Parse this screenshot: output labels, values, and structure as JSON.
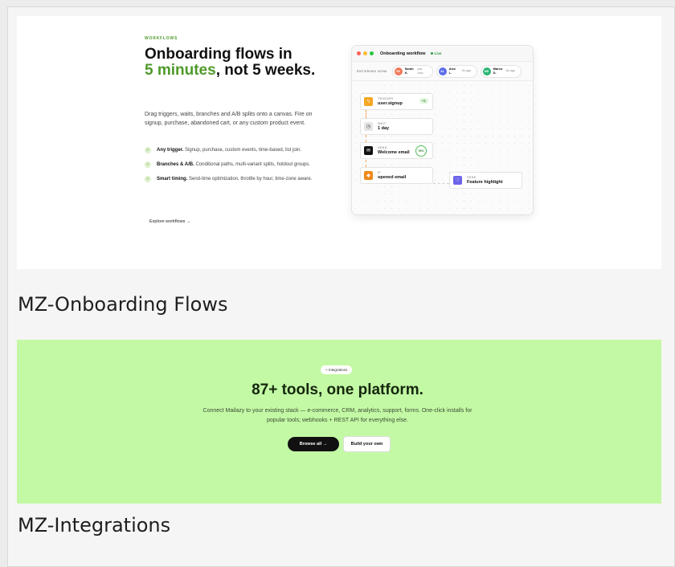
{
  "cards": [
    {
      "caption": "MZ-Onboarding Flows",
      "preview": {
        "eyebrow": "WORKFLOWS",
        "headline_part1": "Onboarding flows in",
        "headline_highlight": "5 minutes",
        "headline_part2": ", not 5 weeks.",
        "description": "Drag triggers, waits, branches and A/B splits onto a canvas. Fire on signup, purchase, abandoned cart, or any custom product event.",
        "bullets": [
          {
            "title": "Any trigger.",
            "text": " Signup, purchase, custom events, time-based, list join."
          },
          {
            "title": "Branches & A/B.",
            "text": " Conditional paths, multi-variant splits, holdout groups."
          },
          {
            "title": "Smart timing.",
            "text": " Send-time optimization, throttle by hour, time-zone aware."
          }
        ],
        "link": "Explore workflows →",
        "workflow": {
          "title": "Onboarding workflow",
          "status": "Live",
          "entering_label": "ENTERING NOW",
          "people": [
            {
              "initials": "SK",
              "name": "Sarah K.",
              "time": "just now",
              "color": "#f07a5a"
            },
            {
              "initials": "AL",
              "name": "Alex L.",
              "time": "2s ago",
              "color": "#5b6ee8"
            },
            {
              "initials": "MD",
              "name": "Marco D.",
              "time": "5s ago",
              "color": "#2bb673"
            }
          ],
          "nodes": [
            {
              "label": "TRIGGER",
              "value": "user.signup",
              "icon": "bolt-icon",
              "badge": "+1"
            },
            {
              "label": "WAIT",
              "value": "1 day",
              "icon": "clock-icon"
            },
            {
              "label": "SEND",
              "value": "Welcome email",
              "icon": "mail-icon",
              "progress": "78%"
            },
            {
              "label": "IF",
              "value": "opened email",
              "icon": "branch-icon"
            },
            {
              "label": "SEND",
              "value": "Feature highlight",
              "icon": "heart-icon"
            }
          ]
        }
      }
    },
    {
      "caption": "MZ-Integrations",
      "preview": {
        "pill": "+ Integrations",
        "title": "87+ tools, one platform.",
        "description": "Connect Mailazy to your existing stack — e-commerce, CRM, analytics, support, forms. One-click installs for popular tools; webhooks + REST API for everything else.",
        "primary_button": "Browse all →",
        "secondary_button": "Build your own"
      }
    }
  ]
}
